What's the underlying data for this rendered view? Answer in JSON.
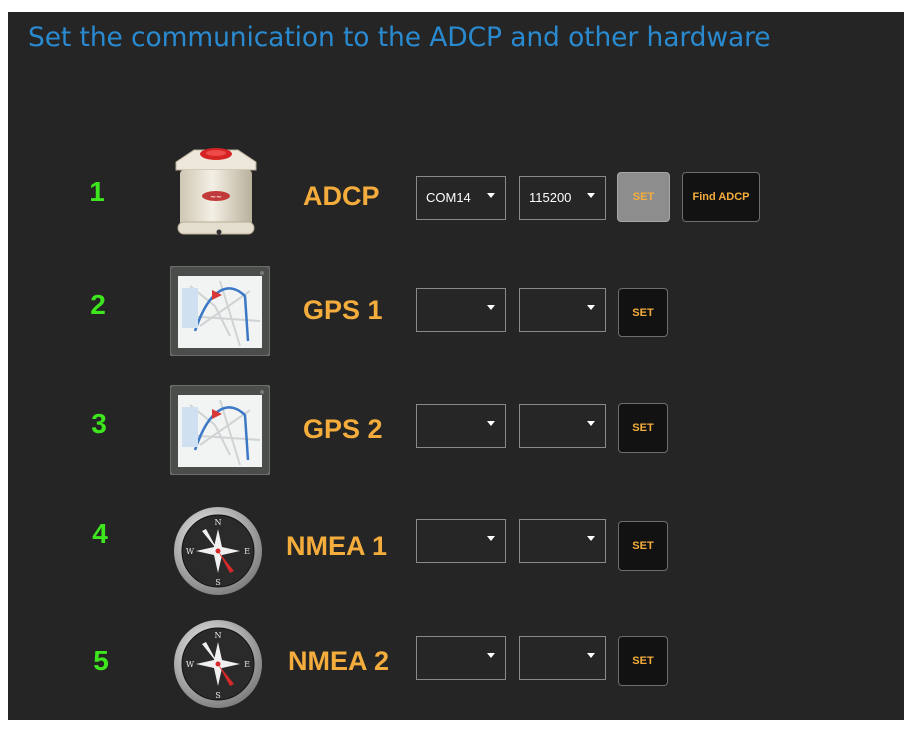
{
  "title": "Set the communication to the ADCP and other hardware",
  "rows": [
    {
      "num": "1",
      "label": "ADCP",
      "icon": "adcp-device-icon",
      "port": "COM14",
      "baud": "115200",
      "set_label": "SET",
      "find_label": "Find ADCP"
    },
    {
      "num": "2",
      "label": "GPS 1",
      "icon": "gps-map-icon",
      "port": "",
      "baud": "",
      "set_label": "SET"
    },
    {
      "num": "3",
      "label": "GPS 2",
      "icon": "gps-map-icon",
      "port": "",
      "baud": "",
      "set_label": "SET"
    },
    {
      "num": "4",
      "label": "NMEA 1",
      "icon": "compass-icon",
      "port": "",
      "baud": "",
      "set_label": "SET"
    },
    {
      "num": "5",
      "label": "NMEA 2",
      "icon": "compass-icon",
      "port": "",
      "baud": "",
      "set_label": "SET"
    }
  ],
  "colors": {
    "title": "#2a8ad0",
    "row_number": "#3ee61e",
    "device_label": "#f4ad3c",
    "background": "#252525"
  }
}
